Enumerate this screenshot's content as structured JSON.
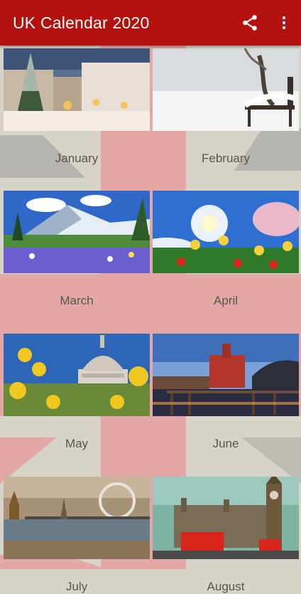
{
  "app": {
    "title": "UK Calendar 2020",
    "actions": [
      {
        "name": "share-icon"
      },
      {
        "name": "more-vertical-icon"
      }
    ]
  },
  "months": [
    {
      "label": "January",
      "image": "snowy-christmas-market-town"
    },
    {
      "label": "February",
      "image": "snow-covered-park-bench"
    },
    {
      "label": "March",
      "image": "mountain-meadow-flowers"
    },
    {
      "label": "April",
      "image": "spring-flowers-blossom"
    },
    {
      "label": "May",
      "image": "st-pauls-cathedral-flowers"
    },
    {
      "label": "June",
      "image": "cardiff-bay-at-dusk"
    },
    {
      "label": "July",
      "image": "london-thames-panorama"
    },
    {
      "label": "August",
      "image": "big-ben-red-bus"
    }
  ],
  "colors": {
    "appbar": "#b3120f",
    "background_red": "#e0a6a4",
    "label_text": "#5a544e"
  }
}
